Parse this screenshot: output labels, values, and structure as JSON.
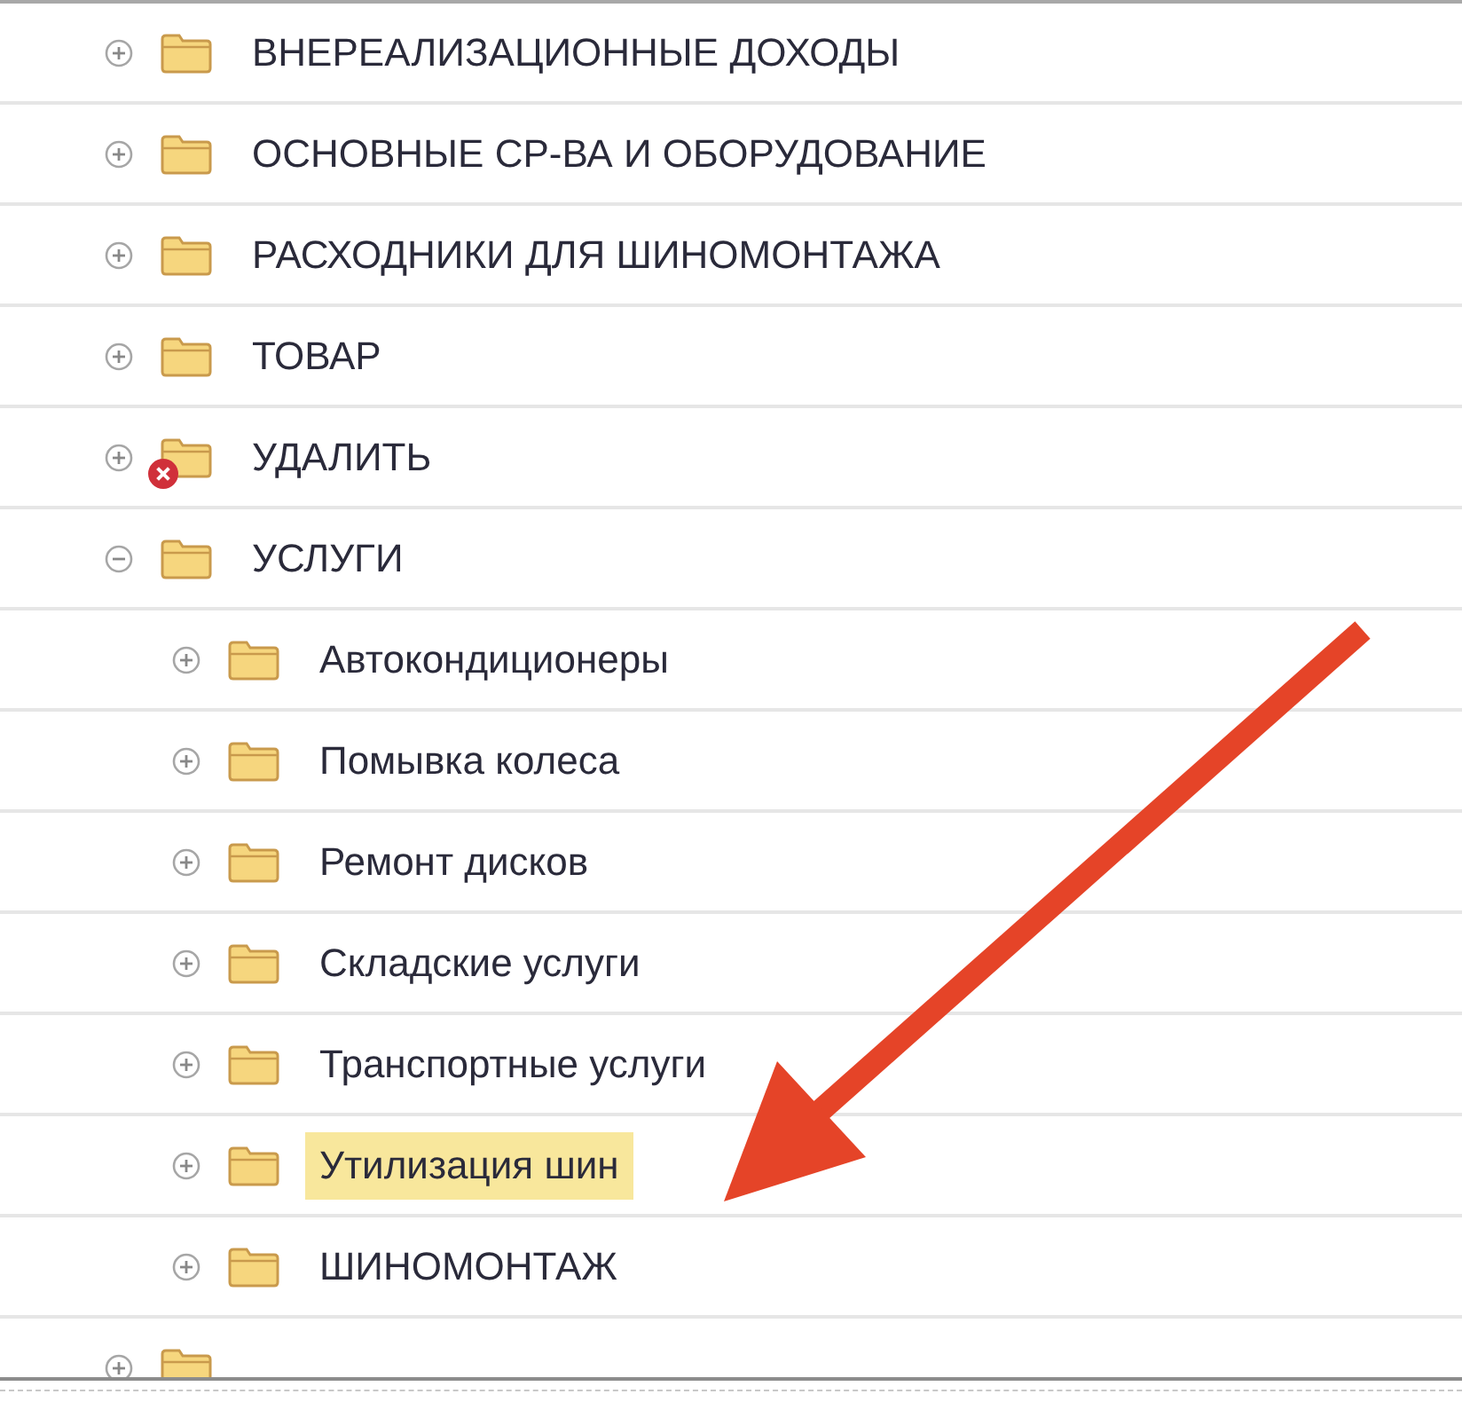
{
  "tree": {
    "items": [
      {
        "label": "ВНЕРЕАЛИЗАЦИОННЫЕ ДОХОДЫ",
        "expanded": false,
        "marked_for_deletion": false,
        "selected": false
      },
      {
        "label": "ОСНОВНЫЕ СР-ВА И ОБОРУДОВАНИЕ",
        "expanded": false,
        "marked_for_deletion": false,
        "selected": false
      },
      {
        "label": "РАСХОДНИКИ ДЛЯ ШИНОМОНТАЖА",
        "expanded": false,
        "marked_for_deletion": false,
        "selected": false
      },
      {
        "label": "ТОВАР",
        "expanded": false,
        "marked_for_deletion": false,
        "selected": false
      },
      {
        "label": "УДАЛИТЬ",
        "expanded": false,
        "marked_for_deletion": true,
        "selected": false
      },
      {
        "label": "УСЛУГИ",
        "expanded": true,
        "marked_for_deletion": false,
        "selected": false,
        "children": [
          {
            "label": "Автокондиционеры",
            "expanded": false,
            "marked_for_deletion": false,
            "selected": false
          },
          {
            "label": "Помывка колеса",
            "expanded": false,
            "marked_for_deletion": false,
            "selected": false
          },
          {
            "label": "Ремонт дисков",
            "expanded": false,
            "marked_for_deletion": false,
            "selected": false
          },
          {
            "label": "Складские услуги",
            "expanded": false,
            "marked_for_deletion": false,
            "selected": false
          },
          {
            "label": "Транспортные услуги",
            "expanded": false,
            "marked_for_deletion": false,
            "selected": false
          },
          {
            "label": "Утилизация шин",
            "expanded": false,
            "marked_for_deletion": false,
            "selected": true
          },
          {
            "label": "ШИНОМОНТАЖ",
            "expanded": false,
            "marked_for_deletion": false,
            "selected": false
          }
        ]
      },
      {
        "expanded": false,
        "marked_for_deletion": false,
        "selected": false
      }
    ]
  }
}
